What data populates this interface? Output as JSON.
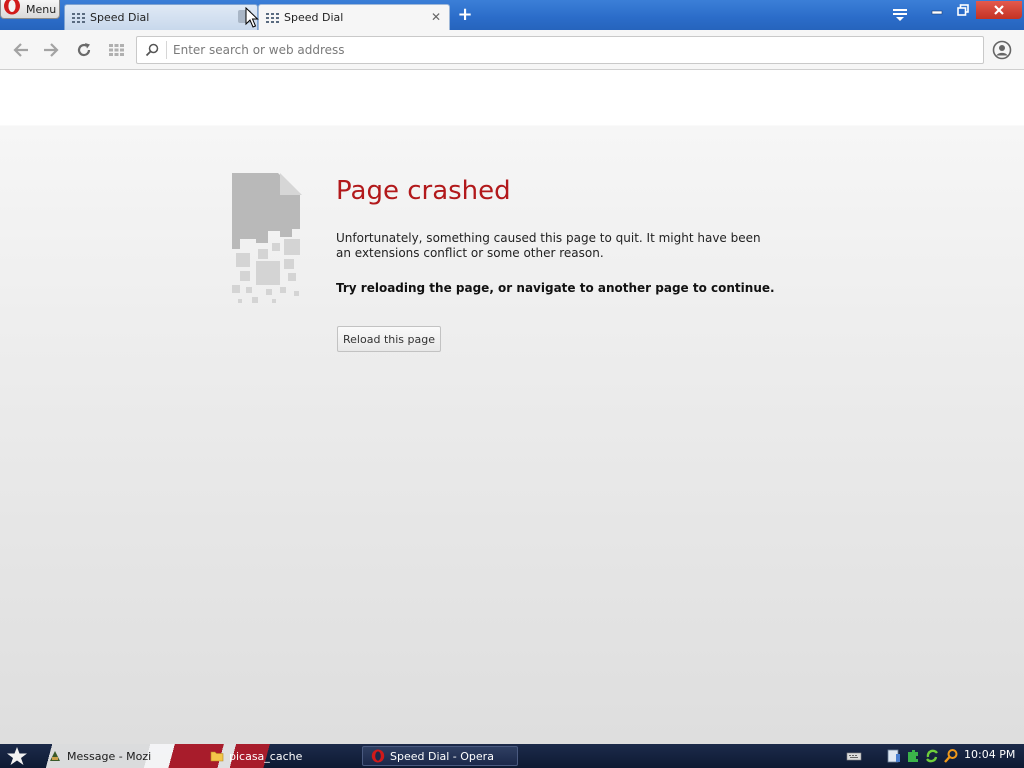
{
  "browser": {
    "menu_label": "Menu",
    "tabs": [
      {
        "title": "Speed Dial",
        "active": false
      },
      {
        "title": "Speed Dial",
        "active": true
      }
    ],
    "new_tab_symbol": "+",
    "close_symbol": "✕",
    "address_placeholder": "Enter search or web address",
    "accent_color": "#2b6cc9"
  },
  "page": {
    "heading": "Page crashed",
    "description": "Unfortunately, something caused this page to quit. It might have been an extensions conflict or some other reason.",
    "hint": "Try reloading the page, or navigate to another page to continue.",
    "reload_button": "Reload this page",
    "heading_color": "#b2191b"
  },
  "taskbar": {
    "items": [
      {
        "label": "Message - Mozi",
        "icon": "app-icon"
      },
      {
        "label": "picasa_cache",
        "icon": "folder-icon"
      },
      {
        "label": "Speed Dial - Opera",
        "icon": "opera-icon"
      }
    ],
    "clock": "10:04 PM"
  }
}
